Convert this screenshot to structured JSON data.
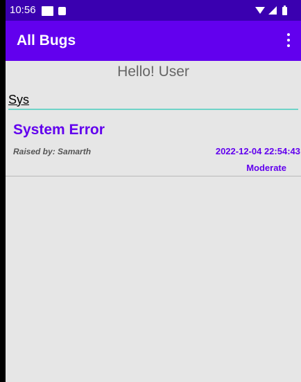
{
  "status_bar": {
    "time": "10:56",
    "icons": [
      "notification-square-icon",
      "notification-rounded-icon",
      "wifi-icon",
      "signal-icon",
      "battery-icon"
    ]
  },
  "app_bar": {
    "title": "All Bugs",
    "menu_icon": "more-vert-icon"
  },
  "greeting": "Hello! User",
  "search": {
    "value": "Sys",
    "placeholder": ""
  },
  "bugs": [
    {
      "title": "System Error",
      "raised_by": "Raised by: Samarth",
      "datetime": "2022-12-04 22:54:43",
      "severity": "Moderate"
    }
  ],
  "colors": {
    "status_bar": "#3a00b0",
    "app_bar": "#6200ee",
    "accent": "#6200ee",
    "input_underline": "#6fd3c8",
    "background": "#e6e6e6"
  }
}
